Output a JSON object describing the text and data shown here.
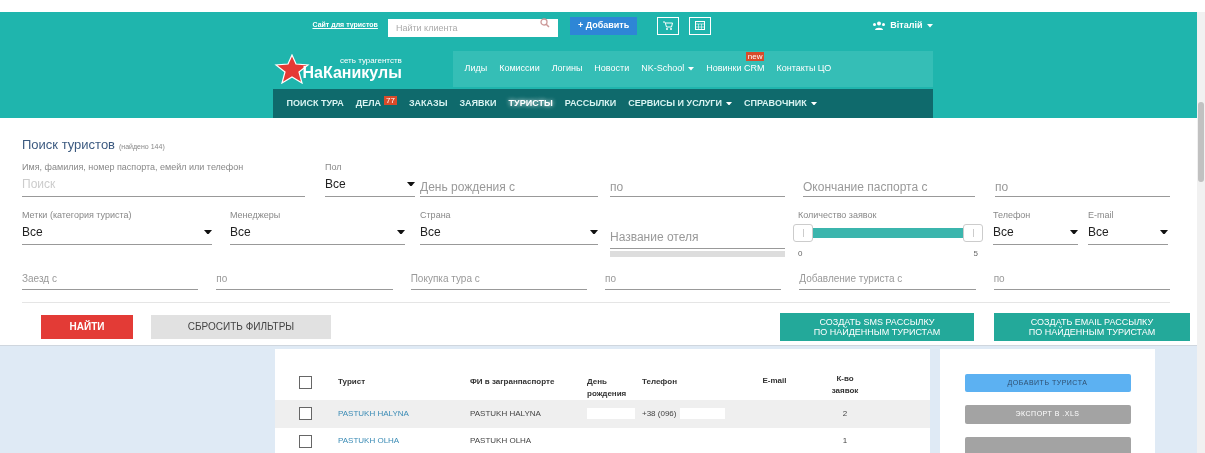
{
  "header": {
    "tourist_site_link": "Сайт для туристов",
    "client_search": {
      "placeholder": "Найти клиента"
    },
    "add_button": "+ Добавить",
    "user": "Віталій",
    "logo": {
      "tagline": "сеть турагентств",
      "name": "НаКаникулы"
    },
    "subnav": [
      {
        "label": "Лиды",
        "has_menu": false
      },
      {
        "label": "Комиссии",
        "has_menu": false
      },
      {
        "label": "Логины",
        "has_menu": false
      },
      {
        "label": "Новости",
        "has_menu": false
      },
      {
        "label": "NK-School",
        "has_menu": true
      },
      {
        "label": "Новинки CRM",
        "has_menu": false,
        "badge": "new"
      },
      {
        "label": "Контакты ЦО",
        "has_menu": false
      }
    ],
    "nav": [
      {
        "label": "ПОИСК ТУРА",
        "selected": false,
        "has_menu": false
      },
      {
        "label": "ДЕЛА",
        "selected": false,
        "has_menu": false,
        "badge": "77"
      },
      {
        "label": "ЗАКАЗЫ",
        "selected": false,
        "has_menu": false
      },
      {
        "label": "ЗАЯВКИ",
        "selected": false,
        "has_menu": false
      },
      {
        "label": "ТУРИСТЫ",
        "selected": true,
        "has_menu": false
      },
      {
        "label": "РАССЫЛКИ",
        "selected": false,
        "has_menu": false
      },
      {
        "label": "СЕРВИСЫ И УСЛУГИ",
        "selected": false,
        "has_menu": true
      },
      {
        "label": "СПРАВОЧНИК",
        "selected": false,
        "has_menu": true
      }
    ]
  },
  "search": {
    "title": "Поиск туристов",
    "found": "(найдено 144)",
    "row1": [
      {
        "kind": "text",
        "label": "Имя, фамилия, номер паспорта, емейл или телефон",
        "placeholder": "Поиск"
      },
      {
        "kind": "select",
        "label": "Пол",
        "value": "Все"
      },
      {
        "kind": "text",
        "placeholder": "День рождения с"
      },
      {
        "kind": "text",
        "placeholder": "по"
      },
      {
        "kind": "text",
        "placeholder": "Окончание паспорта с"
      },
      {
        "kind": "text",
        "placeholder": "по"
      }
    ],
    "row2": [
      {
        "kind": "select",
        "label": "Метки (категория туриста)",
        "value": "Все"
      },
      {
        "kind": "select",
        "label": "Менеджеры",
        "value": "Все"
      },
      {
        "kind": "select",
        "label": "Страна",
        "value": "Все"
      },
      {
        "kind": "hotel",
        "placeholder": "Название отеля"
      },
      {
        "kind": "range",
        "label": "Количество заявок",
        "min": "0",
        "max": "5",
        "level": 1
      },
      {
        "kind": "select",
        "label": "Телефон",
        "value": "Все"
      },
      {
        "kind": "select",
        "label": "E-mail",
        "value": "Все"
      }
    ],
    "row3": [
      {
        "placeholder": "Заезд с"
      },
      {
        "placeholder": "по"
      },
      {
        "placeholder": "Покупка тура с"
      },
      {
        "placeholder": "по"
      },
      {
        "placeholder": "Добавление туриста с"
      },
      {
        "placeholder": "по"
      }
    ],
    "find_button": "НАЙТИ",
    "reset_button": "СБРОСИТЬ ФИЛЬТРЫ",
    "sms_button": [
      "СОЗДАТЬ SMS РАССЫЛКУ",
      "ПО НАЙДЕННЫМ ТУРИСТАМ"
    ],
    "email_button": [
      "СОЗДАТЬ EMAIL РАССЫЛКУ",
      "ПО НАЙДЕННЫМ ТУРИСТАМ"
    ]
  },
  "table": {
    "select_all_checked": false,
    "columns": [
      "Турист",
      "ФИ в загранпаспорте",
      "День рождения",
      "Телефон",
      "E-mail",
      "К-во заявок"
    ],
    "rows": [
      {
        "checked": false,
        "highlighted": true,
        "tourist": "PASTUKH HALYNA",
        "passport_name": "PASTUKH HALYNA",
        "phone": "+38 (096)",
        "count": "2"
      },
      {
        "checked": false,
        "highlighted": false,
        "tourist": "PASTUKH OLHA",
        "passport_name": "PASTUKH OLHA",
        "count": "1"
      }
    ]
  },
  "actions": [
    {
      "label": "ДОБАВИТЬ ТУРИСТА",
      "kind": "primary"
    },
    {
      "label": "ЭКСПОРТ В .XLS",
      "kind": "secondary"
    }
  ]
}
